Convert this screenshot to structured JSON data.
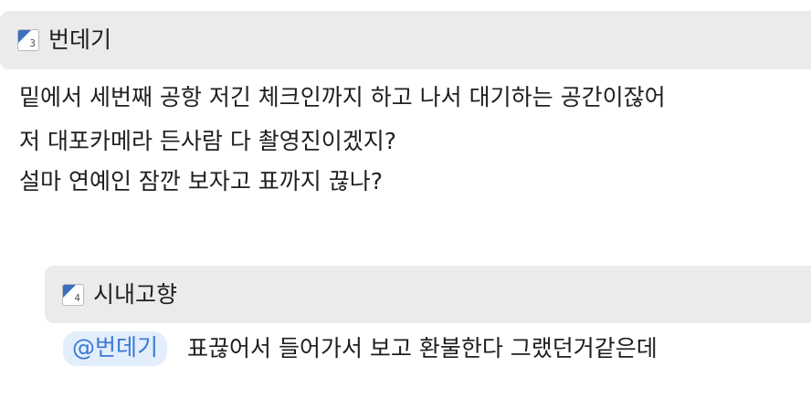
{
  "comments": [
    {
      "level": "3",
      "nickname": "번데기",
      "lines": [
        "밑에서 세번째 공항 저긴 체크인까지 하고 나서 대기하는 공간이잖어",
        "저 대포카메라 든사람 다 촬영진이겠지?",
        "설마 연예인 잠깐 보자고 표까지 끊나?"
      ]
    },
    {
      "level": "4",
      "nickname": "시내고향",
      "mention": "@번데기",
      "text": "표끊어서 들어가서 보고 환불한다 그랬던거같은데"
    }
  ],
  "colors": {
    "header_bg": "#ebebeb",
    "mention_bg": "#e3eefb",
    "mention_text": "#3a78d6",
    "level_icon_accent": "#3d6fbd"
  },
  "icons": {
    "level_badge": "level-badge-icon"
  }
}
